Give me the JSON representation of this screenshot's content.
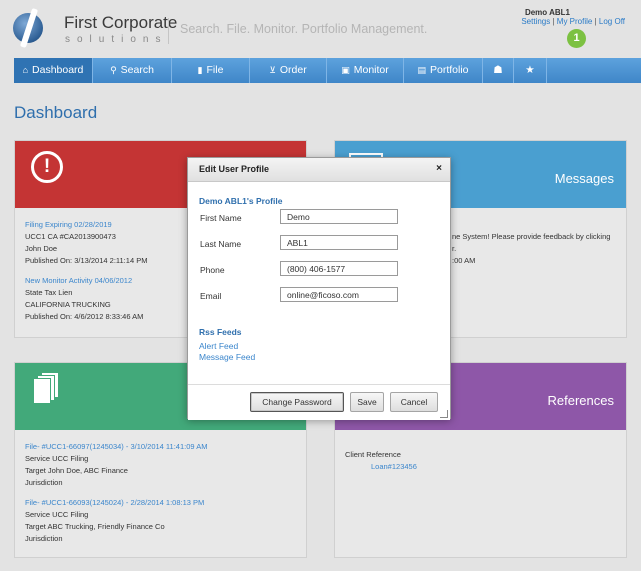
{
  "brand": {
    "name": "First Corporate",
    "sub": "solutions",
    "tagline": "Search. File. Monitor. Portfolio Management."
  },
  "user": {
    "name": "Demo ABL1",
    "links": [
      "Settings",
      "My Profile",
      "Log Off"
    ],
    "separator": "|",
    "badge_count": "1"
  },
  "nav": {
    "items": [
      {
        "icon": "home-icon",
        "glyph": "⌂",
        "label": "Dashboard"
      },
      {
        "icon": "search-icon",
        "glyph": "⚲",
        "label": "Search"
      },
      {
        "icon": "file-icon",
        "glyph": "▮",
        "label": "File"
      },
      {
        "icon": "cart-icon",
        "glyph": "⊻",
        "label": "Order"
      },
      {
        "icon": "monitor-icon",
        "glyph": "▣",
        "label": "Monitor"
      },
      {
        "icon": "portfolio-icon",
        "glyph": "▤",
        "label": "Portfolio"
      },
      {
        "icon": "user-icon",
        "glyph": "☗",
        "label": ""
      },
      {
        "icon": "star-icon",
        "glyph": "★",
        "label": ""
      }
    ]
  },
  "page": {
    "title": "Dashboard"
  },
  "alerts_card": {
    "items": [
      {
        "link": "Filing Expiring 02/28/2019",
        "lines": [
          "UCC1 CA #CA2013900473",
          "John Doe",
          "Published On: 3/13/2014 2:11:14 PM"
        ]
      },
      {
        "link": "New Monitor Activity 04/06/2012",
        "lines": [
          "State Tax Lien",
          "CALIFORNIA TRUCKING",
          "Published On: 4/6/2012 8:33:46 AM"
        ]
      }
    ]
  },
  "messages_card": {
    "title": "Messages",
    "lines": [
      "ne System! Please provide feedback by clicking",
      "r.",
      ":00 AM"
    ]
  },
  "filings_card": {
    "items": [
      {
        "link": "File- #UCC1-66097(1245034) - 3/10/2014 11:41:09 AM",
        "lines": [
          "Service UCC Filing",
          "Target John Doe, ABC Finance",
          "Jurisdiction"
        ]
      },
      {
        "link": "File- #UCC1-66093(1245024) - 2/28/2014 1:08:13 PM",
        "lines": [
          "Service UCC Filing",
          "Target ABC Trucking, Friendly Finance Co",
          "Jurisdiction"
        ]
      }
    ]
  },
  "references_card": {
    "title": "References",
    "label": "Client Reference",
    "link": "Loan#123456"
  },
  "modal": {
    "title": "Edit User Profile",
    "close": "×",
    "section": "Demo ABL1's Profile",
    "fields": [
      {
        "label": "First Name",
        "value": "Demo"
      },
      {
        "label": "Last Name",
        "value": "ABL1"
      },
      {
        "label": "Phone",
        "value": "(800) 406-1577"
      },
      {
        "label": "Email",
        "value": "online@ficoso.com"
      }
    ],
    "rss_title": "Rss Feeds",
    "feeds": [
      "Alert Feed",
      "Message Feed"
    ],
    "buttons": {
      "change_password": "Change Password",
      "save": "Save",
      "cancel": "Cancel"
    }
  }
}
